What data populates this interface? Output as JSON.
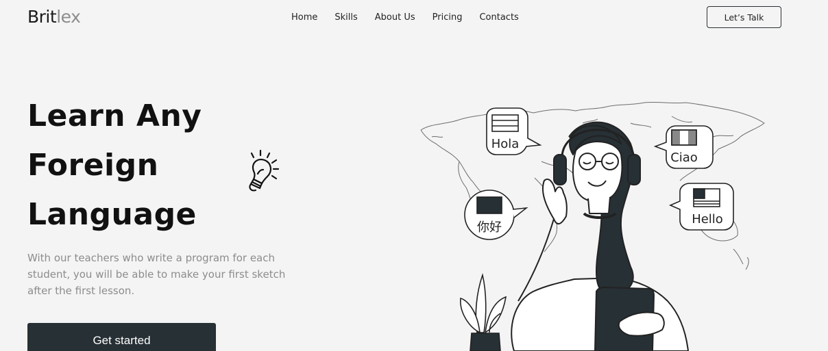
{
  "header": {
    "logo_part1": "Brit",
    "logo_part2": "lex",
    "nav": [
      "Home",
      "Skills",
      "About Us",
      "Pricing",
      "Contacts"
    ],
    "cta_label": "Let’s Talk"
  },
  "hero": {
    "title_lines": [
      "Learn Any",
      "Foreign",
      "Language"
    ],
    "subtitle": "With our teachers who write a program for each student, you will be able to make your first sketch after the first lesson.",
    "button_label": "Get started"
  },
  "illustration": {
    "bubbles": {
      "spanish": "Hola",
      "italian": "Ciao",
      "chinese": "你好",
      "english": "Hello"
    }
  },
  "colors": {
    "background": "#f4f4f4",
    "dark": "#273035",
    "muted_text": "#8c8c8c",
    "logo_muted": "#8d8d8d"
  },
  "icons": [
    "lightbulb-icon"
  ]
}
